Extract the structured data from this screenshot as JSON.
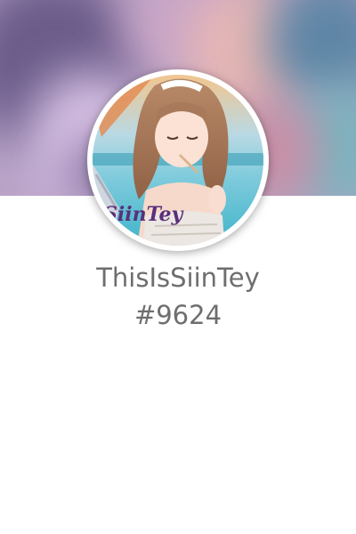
{
  "profile": {
    "username": "ThisIsSiinTey",
    "discriminator": "#9624",
    "avatar_watermark": "SiinTey"
  },
  "colors": {
    "text": "#6e6e6e",
    "background": "#ffffff",
    "avatar_border": "#ffffff"
  }
}
